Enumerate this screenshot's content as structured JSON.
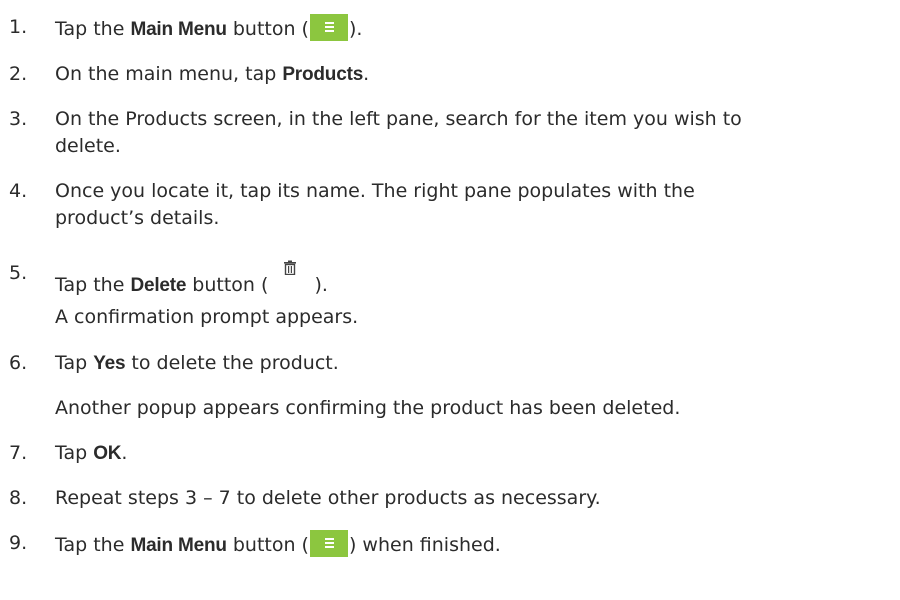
{
  "steps": [
    {
      "num": "1.",
      "pre": "Tap the ",
      "bold": "Main Menu",
      "mid": " button (",
      "icon": "main-menu-icon",
      "post": ")."
    },
    {
      "num": "2.",
      "pre": "On the main menu, tap ",
      "bold": "Products",
      "post": "."
    },
    {
      "num": "3.",
      "line1": "On the Products screen, in the left pane, search for the item you wish to",
      "line2": "delete."
    },
    {
      "num": "4.",
      "line1": "Once you locate it, tap its name. The right pane populates with the",
      "line2": "product’s details."
    },
    {
      "num": "5.",
      "pre": "Tap the ",
      "bold": "Delete",
      "mid": " button (",
      "icon": "delete-icon",
      "post": ").",
      "note": "A confirmation prompt appears."
    },
    {
      "num": "6.",
      "pre": "Tap ",
      "bold": "Yes",
      "post": " to delete the product.",
      "note": "Another popup appears confirming the product has been deleted."
    },
    {
      "num": "7.",
      "pre": "Tap ",
      "bold": "OK",
      "post": "."
    },
    {
      "num": "8.",
      "text": "Repeat steps 3 – 7 to delete other products as necessary."
    },
    {
      "num": "9.",
      "pre": "Tap the ",
      "bold": "Main Menu",
      "mid": " button (",
      "icon": "main-menu-icon",
      "post": ") when finished."
    }
  ],
  "colors": {
    "text": "#2b2b2b",
    "menu_button": "#8cc63f",
    "trash_icon": "#444444"
  }
}
